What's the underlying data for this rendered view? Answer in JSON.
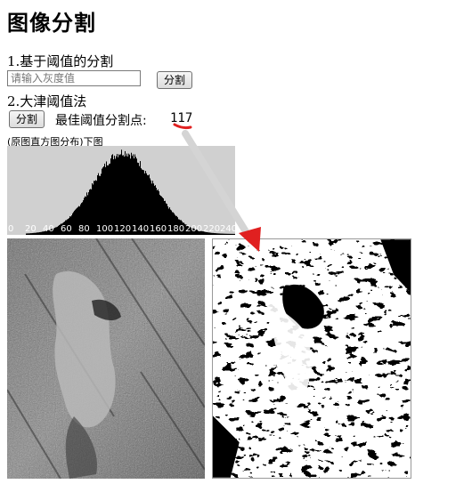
{
  "page": {
    "title": "图像分割"
  },
  "section1": {
    "heading": "1.基于阈值的分割",
    "input_placeholder": "请输入灰度值",
    "button_label": "分割"
  },
  "section2": {
    "heading": "2.大津阈值法",
    "button_label": "分割",
    "best_threshold_label": "最佳阈值分割点:",
    "best_threshold_value": "117"
  },
  "histogram": {
    "caption": "(原图直方图分布)下图",
    "tick_labels": [
      "0",
      "20",
      "40",
      "60",
      "80",
      "100",
      "120",
      "140",
      "160",
      "180",
      "200",
      "220",
      "240"
    ]
  },
  "colors": {
    "histogram_bg": "#d0d0d0",
    "annotation_red": "#e02020",
    "arrow_gray": "#d4d4d4"
  }
}
